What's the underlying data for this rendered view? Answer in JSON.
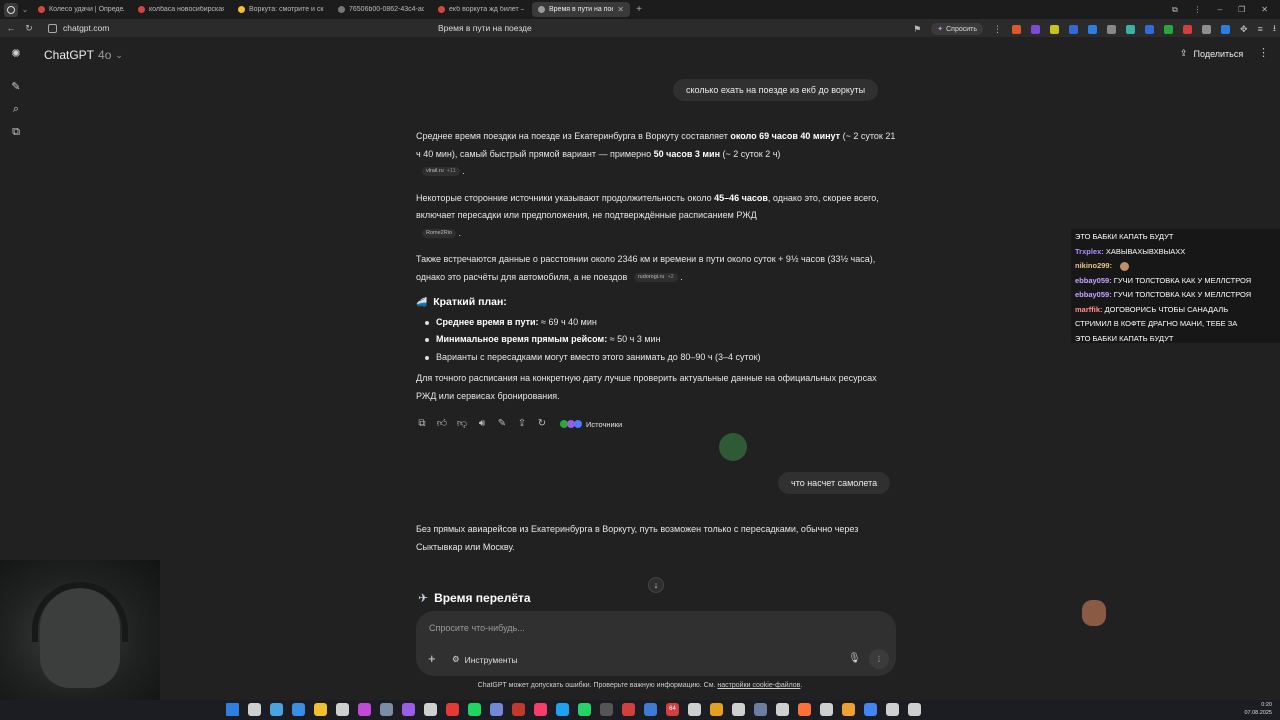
{
  "browser": {
    "tabs": [
      {
        "label": "Колесо удачи | Определе",
        "color": "#d64545",
        "active": false
      },
      {
        "label": "колбаса новосибирская",
        "color": "#d64545",
        "active": false
      },
      {
        "label": "Воркута: смотрите и ска",
        "color": "#f2c12e",
        "active": false
      },
      {
        "label": "76506b00-0862-43c4-acc",
        "color": "#777777",
        "active": false
      },
      {
        "label": "екб воркута жд билет –",
        "color": "#d64545",
        "active": false
      },
      {
        "label": "Время в пути на поезд",
        "color": "#9a9a9a",
        "active": true
      }
    ],
    "url": "chatgpt.com",
    "page_title": "Время в пути на поезде",
    "ask_label": "Спросить"
  },
  "header": {
    "model_name": "ChatGPT",
    "model_version": "4o",
    "share_label": "Поделиться"
  },
  "conversation": {
    "user_msg_1": "сколько ехать на поезде из екб до воркуты",
    "a1_p1_pre": "Среднее время поездки на поезде из Екатеринбурга в Воркуту составляет ",
    "a1_p1_bold1": "около 69 часов 40 минут",
    "a1_p1_mid": " (~ 2 суток 21 ч 40 мин), самый быстрый прямой вариант — примерно ",
    "a1_p1_bold2": "50 часов 3 мин",
    "a1_p1_post": " (~ 2 суток 2 ч)",
    "chip1": "vlrail.ru",
    "chip1_more": "+11",
    "a1_p2_pre": "Некоторые сторонние источники указывают продолжительность около ",
    "a1_p2_bold": "45–46 часов",
    "a1_p2_post": ", однако это, скорее всего, включает пересадки или предположения, не подтверждённые расписанием РЖД",
    "chip2": "Rome2Rio",
    "a1_p3": "Также встречаются данные о расстоянии около 2346 км и времени в пути около суток + 9½ часов (33½ часа), однако это расчёты для автомобиля, а не поездов",
    "chip3": "rudorogi.ru",
    "chip3_more": "+2",
    "plan_title": "Краткий план:",
    "b1_bold": "Среднее время в пути:",
    "b1_rest": " ≈ 69 ч 40 мин",
    "b2_bold": "Минимальное время прямым рейсом:",
    "b2_rest": " ≈ 50 ч 3 мин",
    "b3": "Варианты с пересадками могут вместо этого занимать до 80–90 ч (3–4 суток)",
    "a1_final": "Для точного расписания на конкретную дату лучше проверить актуальные данные на официальных ресурсах РЖД или сервисах бронирования.",
    "sources_label": "Источники",
    "user_msg_2": "что насчет самолета",
    "a2_p1": "Без прямых авиарейсов из Екатеринбурга в Воркуту, путь возможен только с пересадками, обычно через Сыктывкар или Москву.",
    "a2_heading": "Время перелёта"
  },
  "composer": {
    "placeholder": "Спросите что-нибудь...",
    "tools_label": "Инструменты"
  },
  "disclaimer": {
    "text": "ChatGPT может допускать ошибки. Проверьте важную информацию. См. ",
    "link": "настройки cookie-файлов",
    "end": "."
  },
  "stream_chat": [
    {
      "nick": "",
      "text": "ЭТО БАБКИ КАПАТЬ БУДУТ",
      "color": "#ffffff"
    },
    {
      "nick": "Trxplex:",
      "text": " ХАВЫВАХЫВХВЫАХХ",
      "color": "#b18cff"
    },
    {
      "nick": "nikino299:",
      "text": "",
      "color": "#e8c48a"
    },
    {
      "nick": "ebbay059:",
      "text": " ГУЧИ ТОЛСТОВКА КАК У МЕЛЛСТРОЯ",
      "color": "#c9a3ff"
    },
    {
      "nick": "ebbay059:",
      "text": " ГУЧИ ТОЛСТОВКА КАК У МЕЛЛСТРОЯ",
      "color": "#c9a3ff"
    },
    {
      "nick": "marffik:",
      "text": " ДОГОВОРИСЬ ЧТОБЫ САНАДАЛЬ",
      "color": "#ff8f8f"
    },
    {
      "nick": "",
      "text": "СТРИМИЛ В КОФТЕ ДРАГНО МАНИ, ТЕБЕ ЗА",
      "color": "#ffffff"
    },
    {
      "nick": "",
      "text": "ЭТО БАБКИ КАПАТЬ БУДУТ",
      "color": "#ffffff"
    }
  ],
  "taskbar": {
    "time": "0:20",
    "date": "07.08.2025",
    "tray_badge": "64"
  }
}
